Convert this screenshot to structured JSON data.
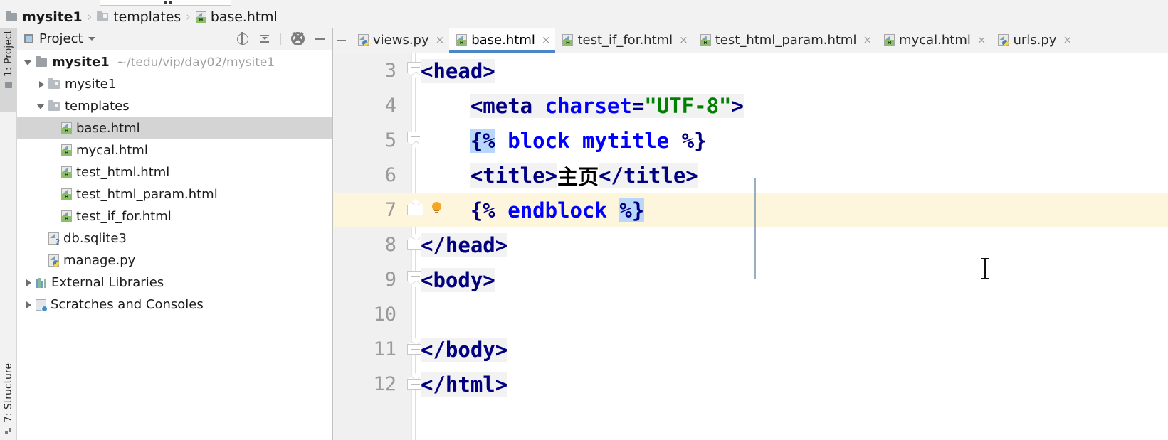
{
  "breadcrumb": {
    "items": [
      {
        "label": "mysite1",
        "icon": "folder-icon",
        "root": true
      },
      {
        "label": "templates",
        "icon": "folder-icon",
        "root": false
      },
      {
        "label": "base.html",
        "icon": "html-file-icon",
        "root": false
      }
    ],
    "separator": "›"
  },
  "toolwindow_tabs": [
    {
      "label": "1: Project",
      "icon": "project-folder-icon",
      "active": true
    },
    {
      "label": "7: Structure",
      "icon": "structure-icon",
      "active": false
    }
  ],
  "project_panel": {
    "title": "Project",
    "title_icon": "project-icon",
    "caret_icon": "chevron-down-icon",
    "tools": [
      {
        "name": "locate-icon",
        "title": "Select Opened File"
      },
      {
        "name": "collapse-all-icon",
        "title": "Collapse All"
      },
      {
        "name": "gear-icon",
        "title": "Settings"
      },
      {
        "name": "hide-icon",
        "title": "Hide"
      }
    ],
    "tree": [
      {
        "label": "mysite1",
        "path": "~/tedu/vip/day02/mysite1",
        "icon": "folder-icon",
        "indent": 0,
        "twisty": "open",
        "bold": true,
        "selected": false
      },
      {
        "label": "mysite1",
        "path": "",
        "icon": "folder-light-icon",
        "indent": 1,
        "twisty": "closed",
        "bold": false,
        "selected": false
      },
      {
        "label": "templates",
        "path": "",
        "icon": "folder-light-icon",
        "indent": 1,
        "twisty": "open",
        "bold": false,
        "selected": false
      },
      {
        "label": "base.html",
        "path": "",
        "icon": "html-file-icon",
        "indent": 2,
        "twisty": "none",
        "bold": false,
        "selected": true
      },
      {
        "label": "mycal.html",
        "path": "",
        "icon": "html-file-icon",
        "indent": 2,
        "twisty": "none",
        "bold": false,
        "selected": false
      },
      {
        "label": "test_html.html",
        "path": "",
        "icon": "html-file-icon",
        "indent": 2,
        "twisty": "none",
        "bold": false,
        "selected": false
      },
      {
        "label": "test_html_param.html",
        "path": "",
        "icon": "html-file-icon",
        "indent": 2,
        "twisty": "none",
        "bold": false,
        "selected": false
      },
      {
        "label": "test_if_for.html",
        "path": "",
        "icon": "html-file-icon",
        "indent": 2,
        "twisty": "none",
        "bold": false,
        "selected": false
      },
      {
        "label": "db.sqlite3",
        "path": "",
        "icon": "sqlite-file-icon",
        "indent": 1,
        "twisty": "none",
        "bold": false,
        "selected": false
      },
      {
        "label": "manage.py",
        "path": "",
        "icon": "python-file-icon",
        "indent": 1,
        "twisty": "none",
        "bold": false,
        "selected": false
      },
      {
        "label": "External Libraries",
        "path": "",
        "icon": "library-icon",
        "indent": 0,
        "twisty": "closed",
        "bold": false,
        "selected": false
      },
      {
        "label": "Scratches and Consoles",
        "path": "",
        "icon": "scratches-icon",
        "indent": 0,
        "twisty": "closed",
        "bold": false,
        "selected": false
      }
    ]
  },
  "editor": {
    "tabs": [
      {
        "label": "views.py",
        "icon": "python-file-icon",
        "active": false,
        "close": "×"
      },
      {
        "label": "base.html",
        "icon": "html-file-icon",
        "active": true,
        "close": "×"
      },
      {
        "label": "test_if_for.html",
        "icon": "html-file-icon",
        "active": false,
        "close": "×"
      },
      {
        "label": "test_html_param.html",
        "icon": "html-file-icon",
        "active": false,
        "close": "×"
      },
      {
        "label": "mycal.html",
        "icon": "html-file-icon",
        "active": false,
        "close": "×"
      },
      {
        "label": "urls.py",
        "icon": "python-file-icon",
        "active": false,
        "close": "×"
      }
    ],
    "accent_color": "#4a86c8",
    "current_line": 7,
    "lines": [
      {
        "number": "3",
        "indent": 0,
        "current": false,
        "fold": "start",
        "tokens": [
          {
            "t": "<head>",
            "c": "tag"
          }
        ]
      },
      {
        "number": "4",
        "indent": 0,
        "current": false,
        "fold": "none",
        "tokens": [
          {
            "t": "    ",
            "c": "plain"
          },
          {
            "t": "<meta ",
            "c": "tag"
          },
          {
            "t": "charset",
            "c": "attr"
          },
          {
            "t": "=",
            "c": "eq"
          },
          {
            "t": "\"UTF-8\"",
            "c": "str"
          },
          {
            "t": ">",
            "c": "tag"
          }
        ]
      },
      {
        "number": "5",
        "indent": 0,
        "current": false,
        "fold": "start",
        "tokens": [
          {
            "t": "    ",
            "c": "plain"
          },
          {
            "t": "{%",
            "c": "hl"
          },
          {
            "t": " ",
            "c": "plain"
          },
          {
            "t": "block",
            "c": "djkw"
          },
          {
            "t": " ",
            "c": "plain"
          },
          {
            "t": "mytitle",
            "c": "djkw"
          },
          {
            "t": " %}",
            "c": "dj"
          }
        ]
      },
      {
        "number": "6",
        "indent": 0,
        "current": false,
        "fold": "none",
        "tokens": [
          {
            "t": "    ",
            "c": "plain"
          },
          {
            "t": "<title>",
            "c": "tag"
          },
          {
            "t": "主页",
            "c": "plain"
          },
          {
            "t": "</title>",
            "c": "tag"
          }
        ]
      },
      {
        "number": "7",
        "indent": 0,
        "current": true,
        "fold": "end",
        "bulb": true,
        "tokens": [
          {
            "t": "    ",
            "c": "plain"
          },
          {
            "t": "{%",
            "c": "dj"
          },
          {
            "t": " ",
            "c": "plain"
          },
          {
            "t": "endblock",
            "c": "djkw"
          },
          {
            "t": " ",
            "c": "plain"
          },
          {
            "t": "%}",
            "c": "hl"
          }
        ]
      },
      {
        "number": "8",
        "indent": 0,
        "current": false,
        "fold": "end",
        "tokens": [
          {
            "t": "</head>",
            "c": "tag"
          }
        ]
      },
      {
        "number": "9",
        "indent": 0,
        "current": false,
        "fold": "start",
        "tokens": [
          {
            "t": "<body>",
            "c": "tag"
          }
        ]
      },
      {
        "number": "10",
        "indent": 0,
        "current": false,
        "fold": "none",
        "tokens": []
      },
      {
        "number": "11",
        "indent": 0,
        "current": false,
        "fold": "end",
        "tokens": [
          {
            "t": "</body>",
            "c": "tag"
          }
        ]
      },
      {
        "number": "12",
        "indent": 0,
        "current": false,
        "fold": "end",
        "tokens": [
          {
            "t": "</html>",
            "c": "tag"
          }
        ]
      }
    ]
  },
  "colors": {
    "tag": "#000080",
    "attribute": "#0000ff",
    "string": "#008000",
    "selection_highlight": "#b8d7fb",
    "current_line_bg": "#fdf6dd",
    "tree_selection_bg": "#d4d4d4",
    "panel_bg": "#f2f2f2",
    "accent": "#4a86c8"
  }
}
